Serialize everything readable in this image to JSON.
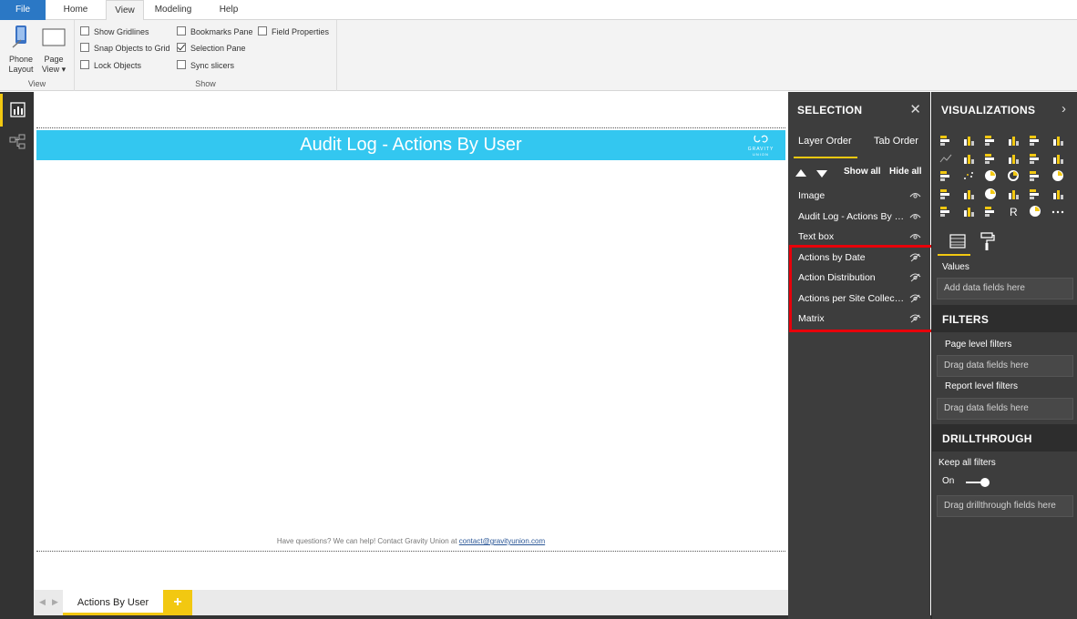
{
  "ribbon": {
    "tabs": [
      "File",
      "Home",
      "View",
      "Modeling",
      "Help"
    ],
    "view_group": {
      "label": "View",
      "phone_layout": [
        "Phone",
        "Layout"
      ],
      "page_view": [
        "Page",
        "View ▾"
      ]
    },
    "show_group": {
      "label": "Show",
      "show_gridlines": "Show Gridlines",
      "snap_objects": "Snap Objects to Grid",
      "lock_objects": "Lock Objects",
      "bookmarks_pane": "Bookmarks Pane",
      "selection_pane": "Selection Pane",
      "sync_slicers": "Sync slicers",
      "field_properties": "Field Properties"
    }
  },
  "canvas": {
    "title": "Audit Log - Actions By User",
    "logo_line1": "GRAVITY",
    "logo_line2": "UNION",
    "footer_prefix": "Have questions? We can help! Contact Gravity Union at ",
    "footer_email": "contact@gravityunion.com"
  },
  "page_tabs": {
    "active": "Actions By User",
    "add": "+"
  },
  "selection": {
    "title": "SELECTION",
    "tabs": [
      "Layer Order",
      "Tab Order"
    ],
    "show_all": "Show all",
    "hide_all": "Hide all",
    "layers": [
      {
        "name": "Image",
        "visible": true
      },
      {
        "name": "Audit Log - Actions By User",
        "visible": true
      },
      {
        "name": "Text box",
        "visible": true
      },
      {
        "name": "Actions by Date",
        "visible": false
      },
      {
        "name": "Action Distribution",
        "visible": false
      },
      {
        "name": "Actions per Site Collection",
        "visible": false
      },
      {
        "name": "Matrix",
        "visible": false
      }
    ],
    "highlight_color": "#e8000a"
  },
  "visualizations": {
    "title": "VISUALIZATIONS",
    "values_label": "Values",
    "values_placeholder": "Add data fields here",
    "filters_title": "FILTERS",
    "page_filters": "Page level filters",
    "page_filters_placeholder": "Drag data fields here",
    "report_filters": "Report level filters",
    "report_filters_placeholder": "Drag data fields here",
    "drill_title": "DRILLTHROUGH",
    "keep_filters": "Keep all filters",
    "toggle_state": "On",
    "drill_placeholder": "Drag drillthrough fields here"
  },
  "colors": {
    "accent": "#f2c811",
    "banner": "#33c7f0",
    "file_tab": "#2b78c5",
    "pane_bg": "#3d3d3d"
  }
}
